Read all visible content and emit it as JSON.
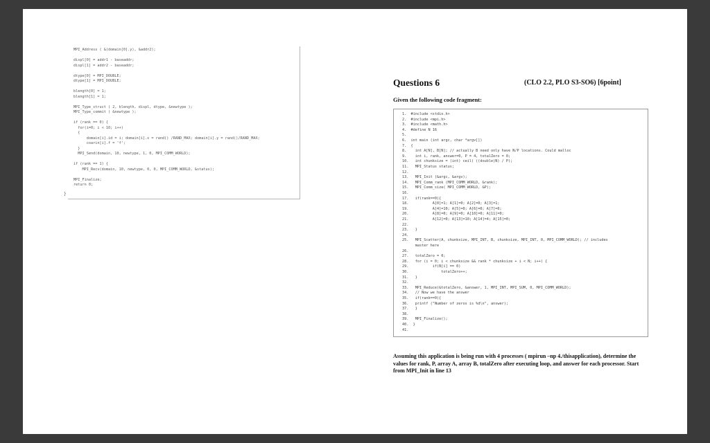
{
  "left_code": [
    "MPI_Address ( &(domain[0].y), &addr2);",
    "",
    "displ[0] = addr1 - baseaddr;",
    "displ[1] = addr2 - baseaddr;",
    "",
    "dtype[0] = MPI_DOUBLE;",
    "dtype[1] = MPI_DOUBLE;",
    "",
    "blength[0] = 1;",
    "blength[1] = 1;",
    "",
    "MPI_Type_struct ( 2, blength, displ, dtype, &newtype );",
    "MPI_Type_commit ( &newtype );",
    "",
    "if (rank == 0) {",
    "  for(i=0; i < 10; i++)",
    "  {",
    "      domain[i].id = i; domain[i].x = rand() /RAND_MAX; domain[i].y = rand()/RAND_MAX;",
    "      coarin[i].f = 'f';",
    "  }",
    "  MPI_Send(domain, 10, newtype, 1, 0, MPI_COMM_WORLD);",
    "",
    "if (rank == 1) {",
    "    MPI_Recv(domain, 10, newtype, 0, 0, MPI_COMM_WORLD, &status);",
    "",
    "MPI_Finalize;",
    "return 0;"
  ],
  "closing_brace": "}",
  "title": "Questions 6",
  "title_meta": "(CLO 2.2, PLO S3-SO6)  [6point]",
  "subtitle": "Given the following code fragment:",
  "code_lines": [
    "1.  #include <stdio.h>",
    "2.  #include <mpi.h>",
    "3.  #include <math.h>",
    "4.  #define N 16",
    "5.",
    "6.  int main (int argc, char *argv[])",
    "7.  {",
    "8.    int A[N], B[N]; // actually B need only have N/P locations. Could malloc",
    "9.    int i, rank, answer=0, P = 4, totalZero = 0;",
    "10.   int chunksize = (int) ceil( ((double)N) / P);",
    "11.   MPI_Status status;",
    "12.",
    "13.   MPI_Init (&argc, &argv);",
    "14.   MPI_Comm_rank (MPI_COMM_WORLD, &rank);",
    "15.   MPI_Comm_size( MPI_COMM_WORLD, &P);",
    "16.",
    "17.   if(rank==0){",
    "18.           A[0]=1; A[1]=0; A[2]=0; A[3]=1;",
    "19.           A[4]=10; A[5]=0; A[6]=0; A[7]=0;",
    "20.           A[8]=0; A[9]=0; A[10]=0; A[11]=0;",
    "21.           A[12]=0; A[13]=10; A[14]=4; A[15]=0;",
    "22.",
    "23.   }",
    "24.",
    "25.   MPI_Scatter(A, chunksize, MPI_INT, B, chunksize, MPI_INT, 0, MPI_COMM_WORLD); // includes",
    "      master here",
    "26.",
    "27.   totalZero = 0;",
    "28.   for (i = 0; i < chunksize && rank * chunksize + i < N; i++) {",
    "29.           if(B[i] == 0)",
    "30.               totalZero++;",
    "31.   }",
    "32.",
    "33.   MPI_Reduce(&totalZero, &answer, 1, MPI_INT, MPI_SUM, 0, MPI_COMM_WORLD);",
    "34.   // Now we have the answer",
    "35.   if(rank==0){",
    "36.   printf (\"Number of zeros is %d\\n\", answer);",
    "37.   }",
    "38.",
    "39.   MPI_Finalize();",
    "40.  }",
    "41."
  ],
  "question_text": "Assuming this application is being run with 4 processes ( mpirun –np 4./thisapplication), determine the values for rank, P, array A, array B, totalZero after executing loop, and answer for each processor.  Start from MPI_Init in line 13"
}
